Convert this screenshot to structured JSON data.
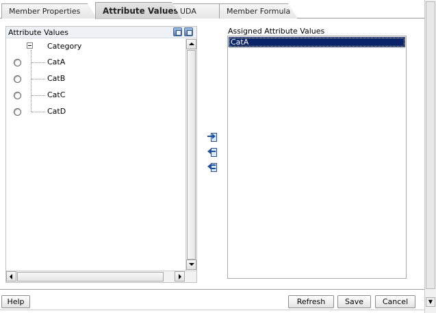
{
  "tabs": [
    {
      "label": "Member Properties",
      "active": false
    },
    {
      "label": "Attribute Values",
      "active": true
    },
    {
      "label": "UDA",
      "active": false
    },
    {
      "label": "Member Formula",
      "active": false
    }
  ],
  "left_panel": {
    "title": "Attribute Values",
    "header_icons": [
      "expand-all-icon",
      "collapse-all-icon"
    ],
    "tree": {
      "root": "Category",
      "items": [
        "CatA",
        "CatB",
        "CatC",
        "CatD"
      ]
    }
  },
  "transfer_buttons": [
    "add-selected-icon",
    "remove-selected-icon",
    "remove-all-icon"
  ],
  "right_panel": {
    "title": "Assigned Attribute Values",
    "items": [
      "CatA"
    ],
    "selected": "CatA"
  },
  "buttons": {
    "help": "Help",
    "refresh": "Refresh",
    "save": "Save",
    "cancel": "Cancel"
  },
  "colors": {
    "selection": "#0a246a",
    "header_bg": "#eef1f6",
    "icon_blue": "#4d79b5"
  }
}
